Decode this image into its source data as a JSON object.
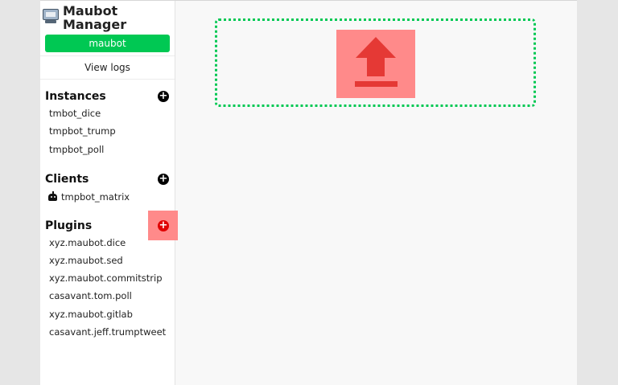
{
  "app": {
    "title": "Maubot Manager",
    "user_button_label": "maubot",
    "view_logs_label": "View logs"
  },
  "sections": {
    "instances": {
      "title": "Instances",
      "items": [
        "tmbot_dice",
        "tmpbot_trump",
        "tmpbot_poll"
      ]
    },
    "clients": {
      "title": "Clients",
      "items": [
        "tmpbot_matrix"
      ]
    },
    "plugins": {
      "title": "Plugins",
      "items": [
        "xyz.maubot.dice",
        "xyz.maubot.sed",
        "xyz.maubot.commitstrip",
        "casavant.tom.poll",
        "xyz.maubot.gitlab",
        "casavant.jeff.trumptweet"
      ]
    }
  },
  "icons": {
    "logo": "maubot-logo-icon",
    "add": "plus-circle-icon",
    "client": "robot-icon",
    "upload": "upload-icon"
  },
  "colors": {
    "accent": "#00c853",
    "highlight": "#ff8a8a",
    "upload_arrow": "#e53935",
    "add_active": "#e00000"
  }
}
